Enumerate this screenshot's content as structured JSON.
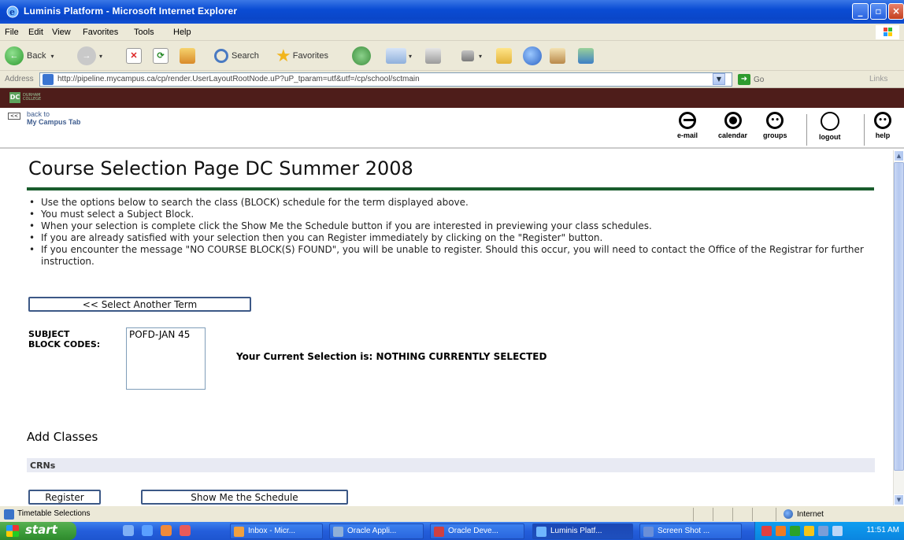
{
  "window": {
    "title": "Luminis Platform - Microsoft Internet Explorer"
  },
  "menu": [
    "File",
    "Edit",
    "View",
    "Favorites",
    "Tools",
    "Help"
  ],
  "toolbar": {
    "back_label": "Back",
    "search_label": "Search",
    "favorites_label": "Favorites"
  },
  "address": {
    "label": "Address",
    "url": "http://pipeline.mycampus.ca/cp/render.UserLayoutRootNode.uP?uP_tparam=utf&utf=/cp/school/sctmain",
    "go_label": "Go",
    "links_label": "Links"
  },
  "portal": {
    "back_line1": "back to",
    "back_line2": "My Campus Tab",
    "icons": [
      {
        "label": "e-mail",
        "icon": "email-icon"
      },
      {
        "label": "calendar",
        "icon": "calendar-icon"
      },
      {
        "label": "groups",
        "icon": "groups-icon"
      },
      {
        "label": "logout",
        "icon": "logout-icon"
      },
      {
        "label": "help",
        "icon": "help-icon"
      }
    ]
  },
  "page": {
    "title": "Course Selection Page DC Summer 2008",
    "instructions": [
      "Use the options below to search the class (BLOCK) schedule for the term displayed above.",
      "You must select a Subject Block.",
      "When your selection is complete click the Show Me the Schedule button if you are interested in previewing your class schedules.",
      "If you are already satisfied with your selection then you can Register immediately by clicking on the \"Register\" button.",
      "If you encounter the message \"NO COURSE BLOCK(S) FOUND\", you will be unable to register. Should this occur, you will need to contact the Office of the Registrar for further instruction."
    ],
    "select_term_button": "<< Select Another Term",
    "subject_label_1": "SUBJECT",
    "subject_label_2": "BLOCK CODES:",
    "subject_options": [
      "POFD-JAN 45"
    ],
    "current_selection_label": "Your Current Selection is:",
    "current_selection_value": "NOTHING CURRENTLY SELECTED",
    "add_classes_heading": "Add Classes",
    "crns_label": "CRNs",
    "register_button": "Register",
    "show_schedule_button": "Show Me the Schedule"
  },
  "status": {
    "text": "Timetable Selections",
    "zone": "Internet"
  },
  "taskbar": {
    "start_label": "start",
    "tasks": [
      {
        "label": "Inbox - Micr..."
      },
      {
        "label": "Oracle Appli..."
      },
      {
        "label": "Oracle Deve..."
      },
      {
        "label": "Luminis Platf..."
      },
      {
        "label": "Screen Shot ..."
      }
    ],
    "clock": "11:51 AM"
  },
  "colors": {
    "brand_bar": "#4e1d1a",
    "rule_green": "#195c2c",
    "xp_blue": "#245edb"
  }
}
